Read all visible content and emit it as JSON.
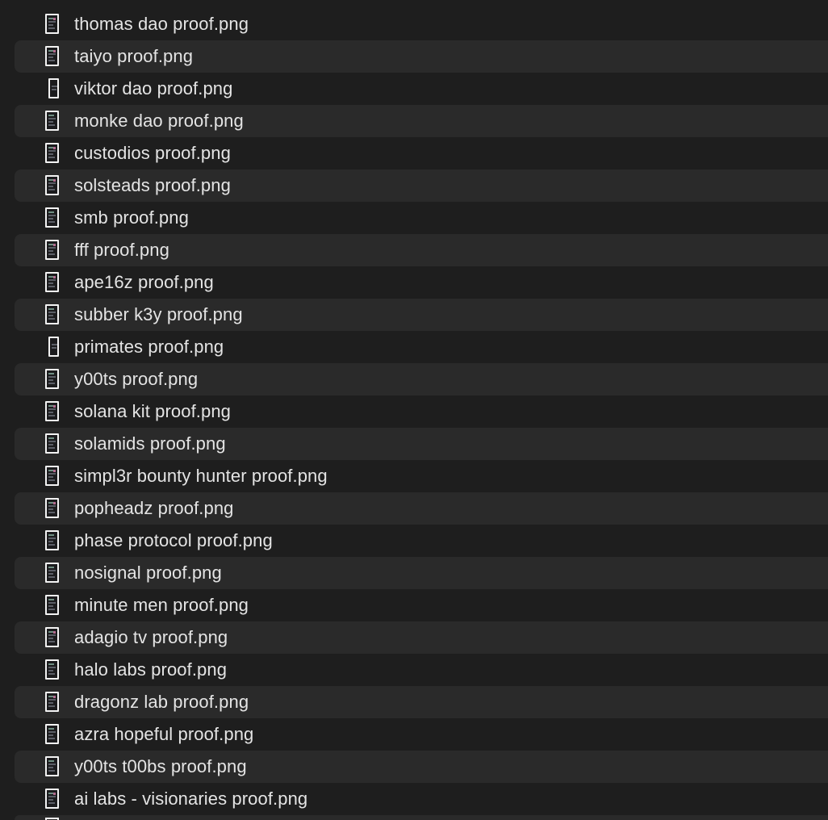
{
  "files": [
    {
      "name": "thomas dao proof.png",
      "thumb": "image-file-icon"
    },
    {
      "name": "taiyo proof.png",
      "thumb": "image-file-icon"
    },
    {
      "name": "viktor dao proof.png",
      "thumb": "image-file-icon"
    },
    {
      "name": "monke dao proof.png",
      "thumb": "image-file-icon"
    },
    {
      "name": "custodios proof.png",
      "thumb": "image-file-icon"
    },
    {
      "name": "solsteads proof.png",
      "thumb": "image-file-icon"
    },
    {
      "name": "smb proof.png",
      "thumb": "image-file-icon"
    },
    {
      "name": "fff proof.png",
      "thumb": "image-file-icon"
    },
    {
      "name": "ape16z proof.png",
      "thumb": "image-file-icon"
    },
    {
      "name": "subber k3y proof.png",
      "thumb": "image-file-icon"
    },
    {
      "name": "primates proof.png",
      "thumb": "image-file-icon"
    },
    {
      "name": "y00ts proof.png",
      "thumb": "image-file-icon"
    },
    {
      "name": "solana kit proof.png",
      "thumb": "image-file-icon"
    },
    {
      "name": "solamids proof.png",
      "thumb": "image-file-icon"
    },
    {
      "name": "simpl3r bounty hunter proof.png",
      "thumb": "image-file-icon"
    },
    {
      "name": "popheadz proof.png",
      "thumb": "image-file-icon"
    },
    {
      "name": "phase protocol proof.png",
      "thumb": "image-file-icon"
    },
    {
      "name": "nosignal proof.png",
      "thumb": "image-file-icon"
    },
    {
      "name": "minute men proof.png",
      "thumb": "image-file-icon"
    },
    {
      "name": "adagio tv proof.png",
      "thumb": "image-file-icon"
    },
    {
      "name": "halo labs proof.png",
      "thumb": "image-file-icon"
    },
    {
      "name": "dragonz lab proof.png",
      "thumb": "image-file-icon"
    },
    {
      "name": "azra hopeful proof.png",
      "thumb": "image-file-icon"
    },
    {
      "name": "y00ts t00bs proof.png",
      "thumb": "image-file-icon"
    },
    {
      "name": "ai labs - visionaries proof.png",
      "thumb": "image-file-icon"
    }
  ],
  "colors": {
    "background": "#1e1e1e",
    "alternate_row": "#2a2a2a",
    "text": "#e4e4e4",
    "thumb_border": "#f2f2f2"
  }
}
